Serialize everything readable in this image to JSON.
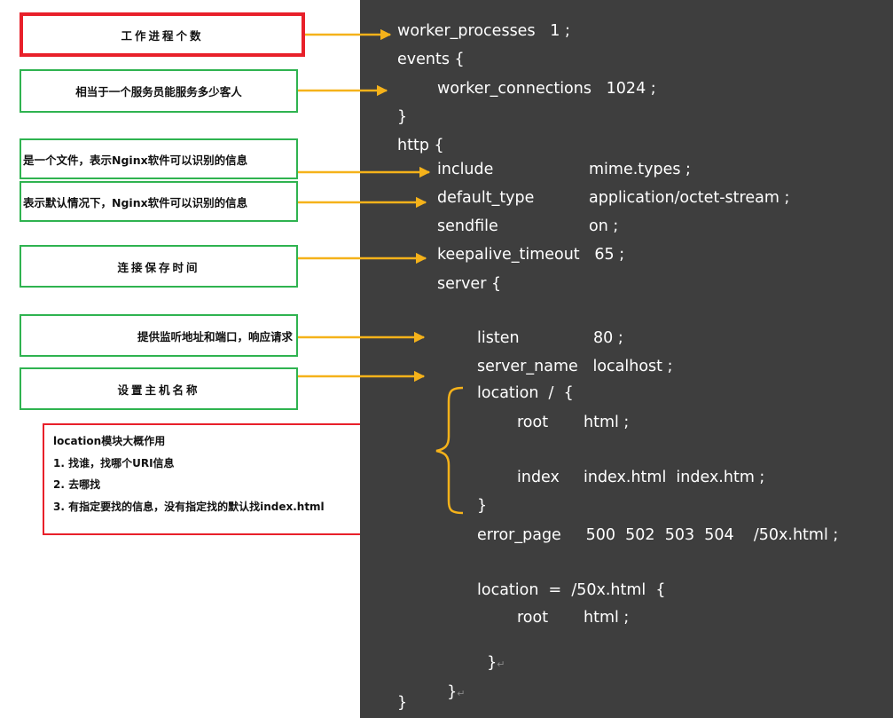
{
  "annotations": {
    "worker_processes": "工作进程个数",
    "worker_connections": "相当于一个服务员能服务多少客人",
    "include": "是一个文件，表示Nginx软件可以识别的信息",
    "default_type": "表示默认情况下，Nginx软件可以识别的信息",
    "keepalive": "连接保存时间",
    "listen": "提供监听地址和端口，响应请求",
    "server_name": "设置主机名称"
  },
  "location_note": {
    "title": "location模块大概作用",
    "item1": "1. 找谁，找哪个URI信息",
    "item2": "2. 去哪找",
    "item3": "3. 有指定要找的信息，没有指定找的默认找index.html"
  },
  "code": {
    "l1": "worker_processes   1 ;",
    "l2": "events {",
    "l3": "worker_connections   1024 ;",
    "l4": "}",
    "l5": "http {",
    "l6a": "include",
    "l6b": "mime.types ;",
    "l7a": "default_type",
    "l7b": "application/octet-stream ;",
    "l8a": "sendfile",
    "l8b": "on ;",
    "l9": "keepalive_timeout   65 ;",
    "l10": "server {",
    "l11a": "listen",
    "l11b": "80 ;",
    "l12": "server_name   localhost ;",
    "l13": "location  /  {",
    "l14a": "root",
    "l14b": "html ;",
    "l15a": "index",
    "l15b": "index.html  index.htm ;",
    "l16": "}",
    "l17": "error_page     500  502  503  504    /50x.html ;",
    "l18": "location  =  /50x.html  {",
    "l19a": "root",
    "l19b": "html ;",
    "l20": "}",
    "l21": "}",
    "l22": "}",
    "return_mark": "↵"
  },
  "colors": {
    "panel_bg": "#3e3e3e",
    "arrow": "#f5b21a",
    "green_border": "#2fb350",
    "red_border": "#e8202a",
    "brace": "#f5b21a"
  }
}
